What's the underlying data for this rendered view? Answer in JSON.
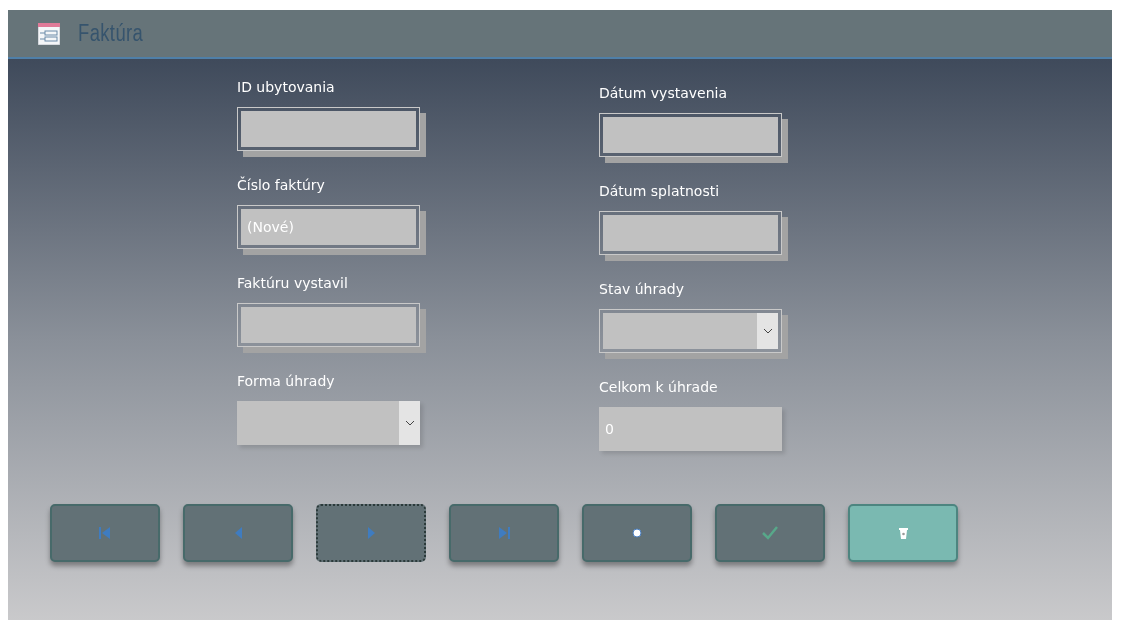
{
  "window": {
    "title": "Faktúra"
  },
  "columns": [
    {
      "fields": [
        {
          "label": "ID ubytovania",
          "kind": "text",
          "framed": true
        },
        {
          "label": "Číslo faktúry",
          "kind": "text",
          "framed": true,
          "value": "(Nové)"
        },
        {
          "label": "Faktúru vystavil",
          "kind": "text",
          "framed": true
        },
        {
          "label": "Forma úhrady",
          "kind": "combo",
          "framed": false
        }
      ]
    },
    {
      "fields": [
        {
          "label": "Dátum vystavenia",
          "kind": "text",
          "framed": true
        },
        {
          "label": "Dátum splatnosti",
          "kind": "text",
          "framed": true
        },
        {
          "label": "Stav úhrady",
          "kind": "combo",
          "framed": true
        },
        {
          "label": "Celkom k úhrade",
          "kind": "text",
          "framed": false,
          "value": "0"
        }
      ]
    }
  ],
  "buttons": [
    {
      "kind": "first",
      "focused": false,
      "highlighted": false
    },
    {
      "kind": "previous",
      "focused": false,
      "highlighted": false
    },
    {
      "kind": "next",
      "focused": true,
      "highlighted": false
    },
    {
      "kind": "last",
      "focused": false,
      "highlighted": false
    },
    {
      "kind": "new",
      "focused": false,
      "highlighted": false
    },
    {
      "kind": "save",
      "focused": false,
      "highlighted": false
    },
    {
      "kind": "delete",
      "focused": false,
      "highlighted": true
    }
  ]
}
